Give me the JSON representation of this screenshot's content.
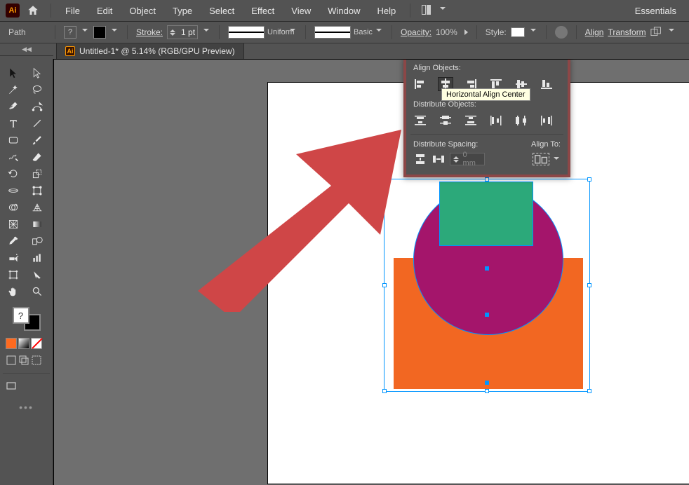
{
  "topbar": {
    "menus": [
      "File",
      "Edit",
      "Object",
      "Type",
      "Select",
      "Effect",
      "View",
      "Window",
      "Help"
    ],
    "workspace": "Essentials"
  },
  "controlbar": {
    "selection_label": "Path",
    "fill_placeholder": "?",
    "stroke_label": "Stroke:",
    "stroke_weight": "1 pt",
    "profile": "Uniform",
    "brush": "Basic",
    "opacity_label": "Opacity:",
    "opacity_value": "100%",
    "style_label": "Style:",
    "align_label": "Align",
    "transform_label": "Transform"
  },
  "document": {
    "tab_title": "Untitled-1* @ 5.14% (RGB/GPU Preview)"
  },
  "align_panel": {
    "section1": "Align Objects:",
    "tooltip": "Horizontal Align Center",
    "section2": "Distribute Objects:",
    "section3": "Distribute Spacing:",
    "spacing_value": "0 mm",
    "align_to_label": "Align To:"
  },
  "collapse_hint": "◀◀",
  "toolbox": {
    "default_fill": "?"
  }
}
